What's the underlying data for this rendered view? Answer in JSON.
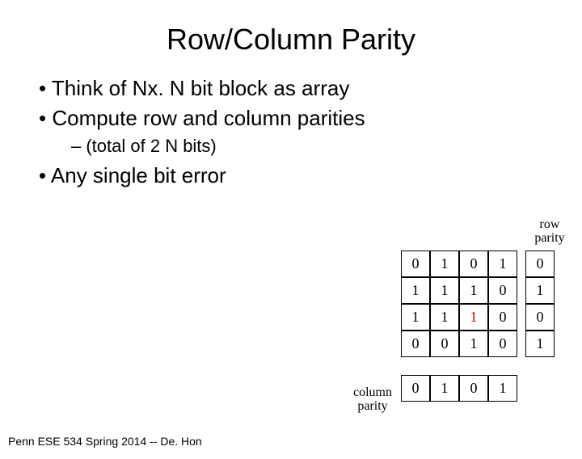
{
  "title": "Row/Column Parity",
  "bullets": {
    "b1": "Think of Nx. N bit block as array",
    "b2": "Compute row and column parities",
    "sub": "(total of 2 N bits)",
    "b3": "Any single bit error"
  },
  "labels": {
    "row_parity_line1": "row",
    "row_parity_line2": "parity",
    "col_parity_line1": "column",
    "col_parity_line2": "parity"
  },
  "chart_data": {
    "type": "table",
    "title": "4x4 bit block with row and column parity",
    "grid": [
      [
        0,
        1,
        0,
        1
      ],
      [
        1,
        1,
        1,
        0
      ],
      [
        1,
        1,
        1,
        0
      ],
      [
        0,
        0,
        1,
        0
      ]
    ],
    "error_cell": {
      "row": 2,
      "col": 2
    },
    "row_parity": [
      0,
      1,
      0,
      1
    ],
    "col_parity": [
      0,
      1,
      0,
      1
    ]
  },
  "footer": "Penn ESE 534 Spring 2014 -- De. Hon"
}
